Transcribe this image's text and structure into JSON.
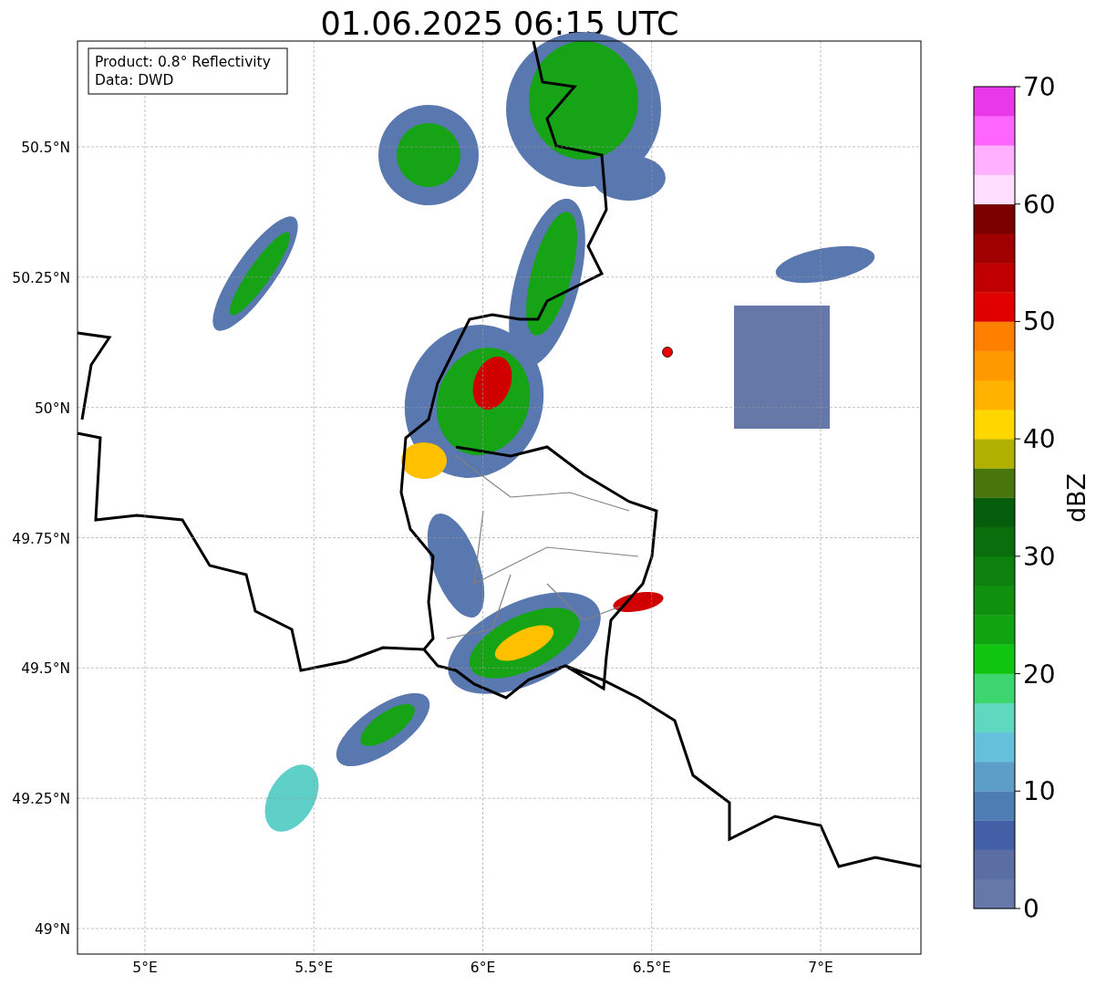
{
  "title": "01.06.2025 06:15 UTC",
  "info_box": [
    "Product: 0.8° Reflectivity",
    "Data: DWD"
  ],
  "map": {
    "lat_ticks": [
      "50.5°N",
      "50.25°N",
      "50°N",
      "49.75°N",
      "49.5°N",
      "49.25°N",
      "49°N"
    ],
    "lon_ticks": [
      "5°E",
      "5.5°E",
      "6°E",
      "6.5°E",
      "7°E"
    ]
  },
  "colorbar": {
    "label": "dBZ",
    "ticks": [
      "70",
      "60",
      "50",
      "40",
      "30",
      "20",
      "10",
      "0"
    ],
    "bins": [
      {
        "color": "#6578a8"
      },
      {
        "color": "#5a6ea4"
      },
      {
        "color": "#4360a6"
      },
      {
        "color": "#4e7db4"
      },
      {
        "color": "#5c9ec8"
      },
      {
        "color": "#65c0dc"
      },
      {
        "color": "#5fd8c0"
      },
      {
        "color": "#3dd66e"
      },
      {
        "color": "#10c510"
      },
      {
        "color": "#10a410"
      },
      {
        "color": "#0f900f"
      },
      {
        "color": "#0e800e"
      },
      {
        "color": "#0a6e0d"
      },
      {
        "color": "#065d0c"
      },
      {
        "color": "#48760c"
      },
      {
        "color": "#afb000"
      },
      {
        "color": "#ffd700"
      },
      {
        "color": "#ffb200"
      },
      {
        "color": "#ff9900"
      },
      {
        "color": "#ff7f00"
      },
      {
        "color": "#e00000"
      },
      {
        "color": "#c00000"
      },
      {
        "color": "#a00000"
      },
      {
        "color": "#7a0000"
      },
      {
        "color": "#ffdfff"
      },
      {
        "color": "#ffb0ff"
      },
      {
        "color": "#ff66ff"
      },
      {
        "color": "#e838e8"
      }
    ]
  }
}
